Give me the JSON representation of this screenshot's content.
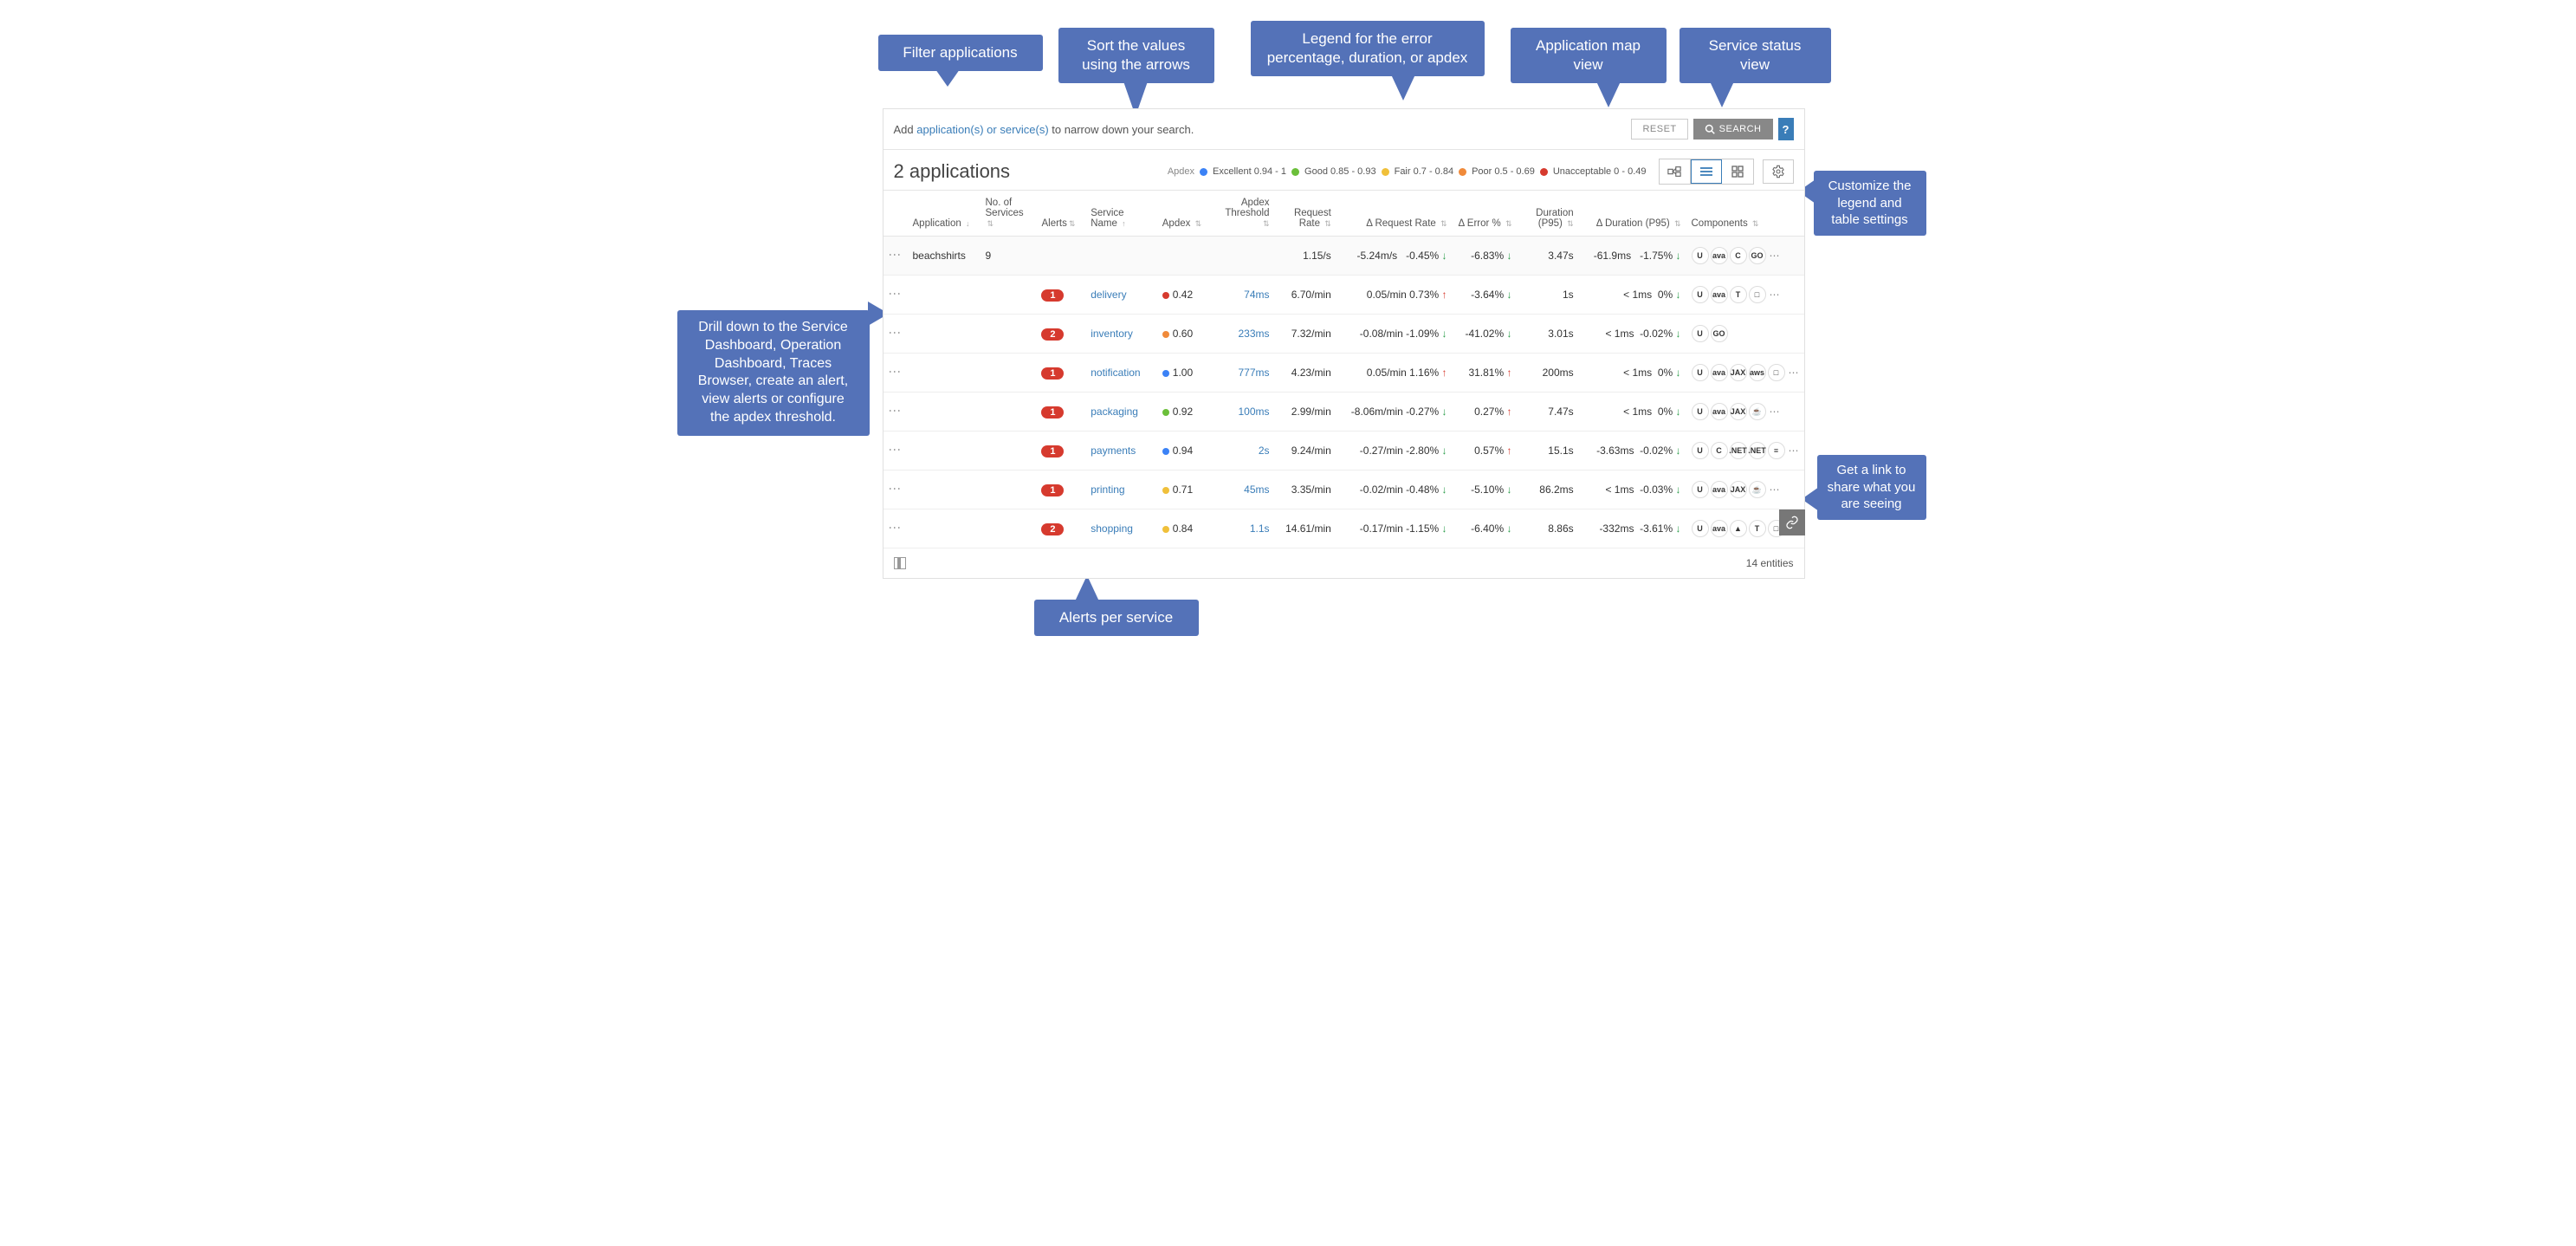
{
  "callouts": {
    "filter": "Filter applications",
    "sort": "Sort the values using the arrows",
    "legend": "Legend for the error percentage, duration, or apdex",
    "mapview": "Application map view",
    "statusview": "Service status view",
    "settings": "Customize the legend and table settings",
    "drilldown": "Drill down to the Service Dashboard, Operation Dashboard, Traces Browser, create an alert, view alerts or configure the apdex threshold.",
    "alerts": "Alerts per service",
    "share": "Get a link to share what you are seeing"
  },
  "search": {
    "hint_prefix": "Add ",
    "hint_link": "application(s) or service(s)",
    "hint_suffix": " to narrow down your search.",
    "reset": "RESET",
    "search": "SEARCH",
    "help": "?"
  },
  "title": "2 applications",
  "legend": {
    "label": "Apdex",
    "items": [
      {
        "label": "Excellent 0.94 - 1",
        "color": "#3b82f6"
      },
      {
        "label": "Good 0.85 - 0.93",
        "color": "#6bbf3a"
      },
      {
        "label": "Fair 0.7 - 0.84",
        "color": "#f0c03a"
      },
      {
        "label": "Poor 0.5 - 0.69",
        "color": "#f08a3a"
      },
      {
        "label": "Unacceptable 0 - 0.49",
        "color": "#d63a2e"
      }
    ]
  },
  "columns": {
    "application": "Application",
    "services": "No. of Services",
    "alerts": "Alerts",
    "service": "Service Name",
    "apdex": "Apdex",
    "threshold": "Apdex Threshold",
    "reqrate": "Request Rate",
    "dreqrate": "Δ Request Rate",
    "derror": "Δ Error %",
    "duration": "Duration (P95)",
    "dduration": "Δ Duration (P95)",
    "components": "Components"
  },
  "app_row": {
    "name": "beachshirts",
    "services": "9",
    "reqrate": "1.15/s",
    "dreqrate": "-5.24m/s",
    "derror_pct": "-0.45%",
    "derror_dir": "down",
    "derror": "-6.83%",
    "derror2_dir": "down",
    "duration": "3.47s",
    "dduration_ms": "-61.9ms",
    "dduration_pct": "-1.75%",
    "dduration_dir": "down",
    "components": [
      "U",
      "ava",
      "C",
      "GO"
    ]
  },
  "rows": [
    {
      "alerts": "1",
      "service": "delivery",
      "apdex": "0.42",
      "apdex_color": "#d63a2e",
      "threshold": "74ms",
      "reqrate": "6.70/min",
      "dreq_val": "0.05/min",
      "dreq_pct": "0.73%",
      "dreq_dir": "up",
      "derror": "-3.64%",
      "derror_dir": "down",
      "duration": "1s",
      "ddur_val": "< 1ms",
      "ddur_pct": "0%",
      "ddur_dir": "down",
      "components": [
        "U",
        "ava",
        "T",
        "□"
      ]
    },
    {
      "alerts": "2",
      "service": "inventory",
      "apdex": "0.60",
      "apdex_color": "#f08a3a",
      "threshold": "233ms",
      "reqrate": "7.32/min",
      "dreq_val": "-0.08/min",
      "dreq_pct": "-1.09%",
      "dreq_dir": "down",
      "derror": "-41.02%",
      "derror_dir": "down",
      "duration": "3.01s",
      "ddur_val": "< 1ms",
      "ddur_pct": "-0.02%",
      "ddur_dir": "down",
      "components": [
        "U",
        "GO"
      ]
    },
    {
      "alerts": "1",
      "service": "notification",
      "apdex": "1.00",
      "apdex_color": "#3b82f6",
      "threshold": "777ms",
      "reqrate": "4.23/min",
      "dreq_val": "0.05/min",
      "dreq_pct": "1.16%",
      "dreq_dir": "up",
      "derror": "31.81%",
      "derror_dir": "up",
      "duration": "200ms",
      "ddur_val": "< 1ms",
      "ddur_pct": "0%",
      "ddur_dir": "down",
      "components": [
        "U",
        "ava",
        "JAX",
        "aws",
        "□"
      ]
    },
    {
      "alerts": "1",
      "service": "packaging",
      "apdex": "0.92",
      "apdex_color": "#6bbf3a",
      "threshold": "100ms",
      "reqrate": "2.99/min",
      "dreq_val": "-8.06m/min",
      "dreq_pct": "-0.27%",
      "dreq_dir": "down",
      "derror": "0.27%",
      "derror_dir": "up",
      "duration": "7.47s",
      "ddur_val": "< 1ms",
      "ddur_pct": "0%",
      "ddur_dir": "down",
      "components": [
        "U",
        "ava",
        "JAX",
        "☕"
      ]
    },
    {
      "alerts": "1",
      "service": "payments",
      "apdex": "0.94",
      "apdex_color": "#3b82f6",
      "threshold": "2s",
      "reqrate": "9.24/min",
      "dreq_val": "-0.27/min",
      "dreq_pct": "-2.80%",
      "dreq_dir": "down",
      "derror": "0.57%",
      "derror_dir": "up",
      "duration": "15.1s",
      "ddur_val": "-3.63ms",
      "ddur_pct": "-0.02%",
      "ddur_dir": "down",
      "components": [
        "U",
        "C",
        ".NET",
        ".NET",
        "≡"
      ]
    },
    {
      "alerts": "1",
      "service": "printing",
      "apdex": "0.71",
      "apdex_color": "#f0c03a",
      "threshold": "45ms",
      "reqrate": "3.35/min",
      "dreq_val": "-0.02/min",
      "dreq_pct": "-0.48%",
      "dreq_dir": "down",
      "derror": "-5.10%",
      "derror_dir": "down",
      "duration": "86.2ms",
      "ddur_val": "< 1ms",
      "ddur_pct": "-0.03%",
      "ddur_dir": "down",
      "components": [
        "U",
        "ava",
        "JAX",
        "☕"
      ]
    },
    {
      "alerts": "2",
      "service": "shopping",
      "apdex": "0.84",
      "apdex_color": "#f0c03a",
      "threshold": "1.1s",
      "reqrate": "14.61/min",
      "dreq_val": "-0.17/min",
      "dreq_pct": "-1.15%",
      "dreq_dir": "down",
      "derror": "-6.40%",
      "derror_dir": "down",
      "duration": "8.86s",
      "ddur_val": "-332ms",
      "ddur_pct": "-3.61%",
      "ddur_dir": "down",
      "components": [
        "U",
        "ava",
        "▲",
        "T",
        "□"
      ]
    }
  ],
  "footer": {
    "entities": "14 entities"
  }
}
